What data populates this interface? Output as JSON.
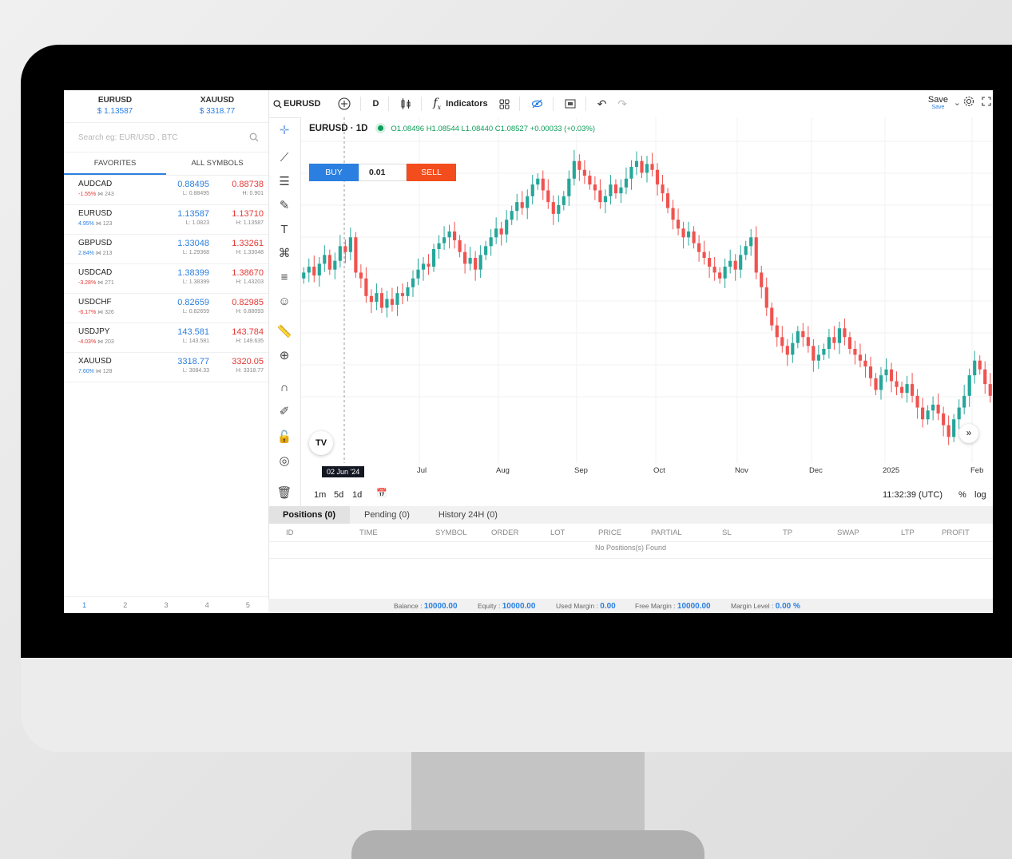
{
  "tickers": [
    {
      "name": "EURUSD",
      "price": "$ 1.13587"
    },
    {
      "name": "XAUUSD",
      "price": "$ 3318.77"
    }
  ],
  "search": {
    "placeholder": "Search eg: EUR/USD , BTC"
  },
  "tabs": {
    "favorites": "FAVORITES",
    "all": "ALL SYMBOLS"
  },
  "symbols": [
    {
      "name": "AUDCAD",
      "chg": "-1.55%",
      "spread": "243",
      "bid": "0.88495",
      "ask": "0.88738",
      "low": "L: 0.88495",
      "high": "H: 0.901",
      "chg_color": "#e53935"
    },
    {
      "name": "EURUSD",
      "chg": "4.95%",
      "spread": "123",
      "bid": "1.13587",
      "ask": "1.13710",
      "low": "L: 1.0823",
      "high": "H: 1.13587",
      "chg_color": "#2b7fe0"
    },
    {
      "name": "GBPUSD",
      "chg": "2.84%",
      "spread": "213",
      "bid": "1.33048",
      "ask": "1.33261",
      "low": "L: 1.29368",
      "high": "H: 1.33048",
      "chg_color": "#2b7fe0"
    },
    {
      "name": "USDCAD",
      "chg": "-3.28%",
      "spread": "271",
      "bid": "1.38399",
      "ask": "1.38670",
      "low": "L: 1.38399",
      "high": "H: 1.43203",
      "chg_color": "#e53935"
    },
    {
      "name": "USDCHF",
      "chg": "-6.17%",
      "spread": "326",
      "bid": "0.82659",
      "ask": "0.82985",
      "low": "L: 0.82659",
      "high": "H: 0.88093",
      "chg_color": "#e53935"
    },
    {
      "name": "USDJPY",
      "chg": "-4.03%",
      "spread": "203",
      "bid": "143.581",
      "ask": "143.784",
      "low": "L: 143.581",
      "high": "H: 149.635",
      "chg_color": "#e53935"
    },
    {
      "name": "XAUUSD",
      "chg": "7.60%",
      "spread": "128",
      "bid": "3318.77",
      "ask": "3320.05",
      "low": "L: 3084.33",
      "high": "H: 3318.77",
      "chg_color": "#2b7fe0"
    }
  ],
  "pager": [
    "1",
    "2",
    "3",
    "4",
    "5"
  ],
  "toolbar": {
    "symbol": "EURUSD",
    "interval": "D",
    "indicators": "Indicators",
    "save": "Save",
    "save_sub": "Save"
  },
  "legend": {
    "title": "EURUSD · 1D",
    "ohlc": "O1.08496 H1.08544 L1.08440 C1.08527 +0.00033 (+0.03%)"
  },
  "trade": {
    "buy": "BUY",
    "lot": "0.01",
    "sell": "SELL"
  },
  "xaxis": {
    "date_chip": "02 Jun '24",
    "labels": [
      "Jul",
      "Aug",
      "Sep",
      "Oct",
      "Nov",
      "Dec",
      "2025",
      "Feb"
    ]
  },
  "tvlogo": "TV",
  "goto": "»",
  "bottom": {
    "tf": [
      "1m",
      "5d",
      "1d"
    ],
    "time": "11:32:39 (UTC)",
    "pct": "%",
    "log": "log"
  },
  "positions": {
    "tabs": [
      "Positions (0)",
      "Pending (0)",
      "History 24H (0)"
    ],
    "headers": [
      "ID",
      "TIME",
      "SYMBOL",
      "ORDER",
      "LOT",
      "PRICE",
      "PARTIAL",
      "SL",
      "TP",
      "SWAP",
      "LTP",
      "PROFIT"
    ],
    "empty": "No Positions(s) Found"
  },
  "status": {
    "balance_label": "Balance : ",
    "balance": "10000.00",
    "equity_label": "Equity : ",
    "equity": "10000.00",
    "used_label": "Used Margin : ",
    "used": "0.00",
    "free_label": "Free Margin : ",
    "free": "10000.00",
    "level_label": "Margin Level : ",
    "level": "0.00 %"
  },
  "chart_data": {
    "type": "candlestick",
    "symbol": "EURUSD",
    "interval": "1D",
    "colors": {
      "up": "#26a69a",
      "down": "#ef5350"
    },
    "close": [
      1.08,
      1.082,
      1.079,
      1.083,
      1.086,
      1.081,
      1.084,
      1.089,
      1.087,
      1.092,
      1.08,
      1.078,
      1.072,
      1.07,
      1.073,
      1.068,
      1.071,
      1.069,
      1.073,
      1.072,
      1.075,
      1.078,
      1.081,
      1.083,
      1.082,
      1.088,
      1.09,
      1.092,
      1.094,
      1.091,
      1.087,
      1.083,
      1.085,
      1.081,
      1.086,
      1.089,
      1.092,
      1.095,
      1.093,
      1.098,
      1.101,
      1.104,
      1.102,
      1.106,
      1.11,
      1.112,
      1.108,
      1.104,
      1.1,
      1.103,
      1.106,
      1.112,
      1.118,
      1.115,
      1.113,
      1.11,
      1.108,
      1.104,
      1.106,
      1.11,
      1.107,
      1.109,
      1.112,
      1.116,
      1.118,
      1.114,
      1.117,
      1.115,
      1.11,
      1.107,
      1.102,
      1.098,
      1.095,
      1.092,
      1.094,
      1.09,
      1.087,
      1.085,
      1.082,
      1.08,
      1.078,
      1.082,
      1.084,
      1.081,
      1.086,
      1.089,
      1.092,
      1.08,
      1.075,
      1.068,
      1.062,
      1.058,
      1.055,
      1.052,
      1.056,
      1.06,
      1.058,
      1.055,
      1.05,
      1.052,
      1.054,
      1.058,
      1.056,
      1.061,
      1.058,
      1.054,
      1.052,
      1.05,
      1.048,
      1.044,
      1.04,
      1.045,
      1.047,
      1.043,
      1.041,
      1.039,
      1.042,
      1.038,
      1.034,
      1.03,
      1.033,
      1.035,
      1.032,
      1.028,
      1.024,
      1.03,
      1.034,
      1.038,
      1.045,
      1.05,
      1.047,
      1.042,
      1.038
    ]
  }
}
